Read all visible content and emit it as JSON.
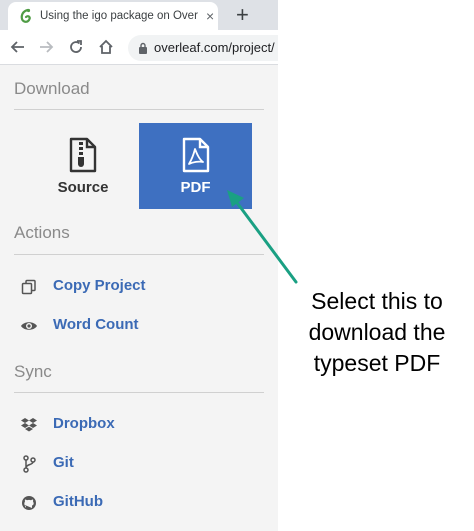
{
  "browser": {
    "tab_title": "Using the igo package on Overleaf",
    "tab_close": "×",
    "new_tab": "+",
    "url": "overleaf.com/project/"
  },
  "sidebar": {
    "download": {
      "title": "Download",
      "source_label": "Source",
      "pdf_label": "PDF"
    },
    "actions": {
      "title": "Actions",
      "items": [
        {
          "label": "Copy Project",
          "icon": "copy-icon"
        },
        {
          "label": "Word Count",
          "icon": "eye-icon"
        }
      ]
    },
    "sync": {
      "title": "Sync",
      "items": [
        {
          "label": "Dropbox",
          "icon": "dropbox-icon"
        },
        {
          "label": "Git",
          "icon": "git-icon"
        },
        {
          "label": "GitHub",
          "icon": "github-icon"
        }
      ]
    }
  },
  "annotation": {
    "text": "Select this to download the typeset PDF"
  },
  "colors": {
    "pdf_button": "#3e70c1",
    "link": "#3b6ab5",
    "arrow": "#1aa083"
  }
}
